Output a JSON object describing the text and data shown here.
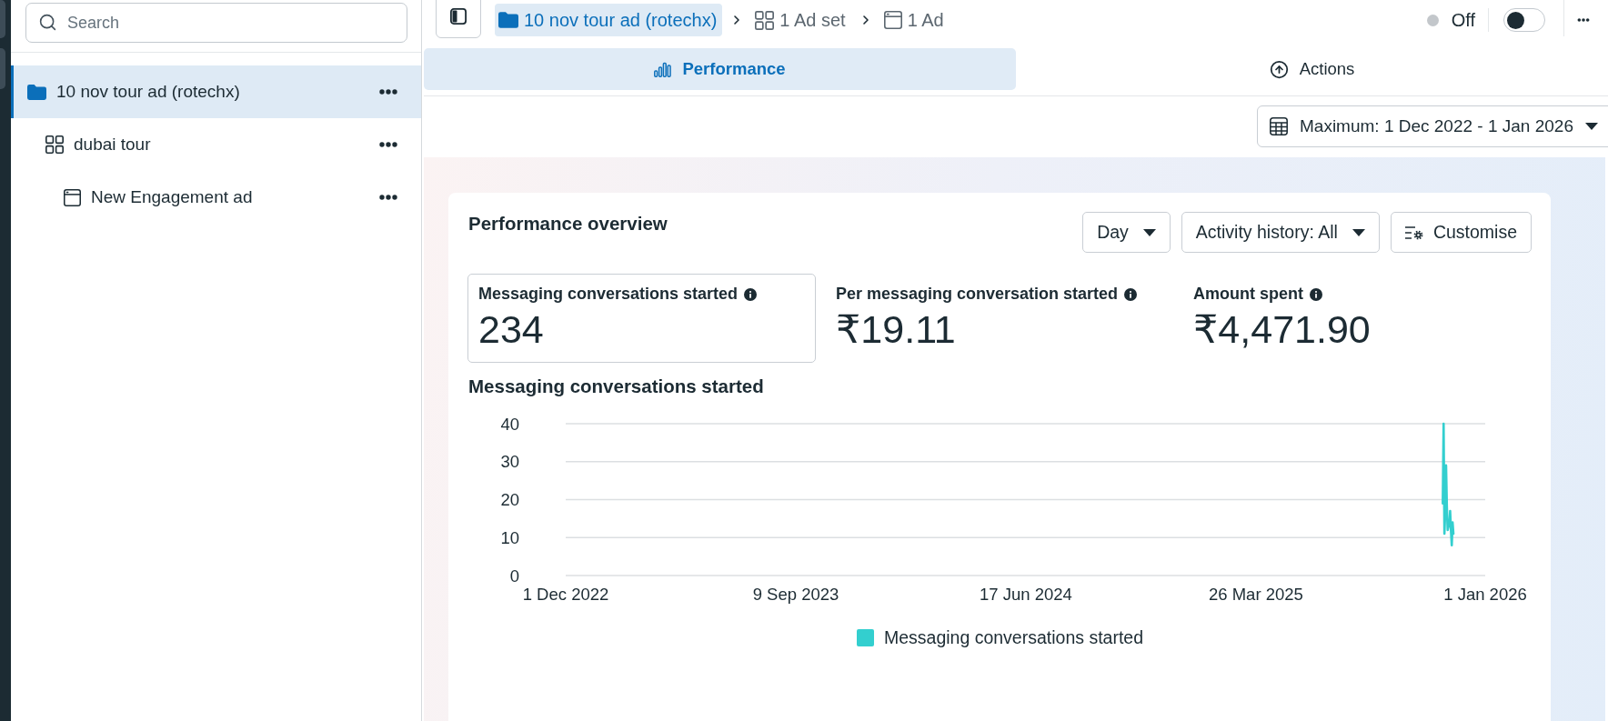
{
  "sidebar": {
    "search": {
      "placeholder": "Search"
    },
    "tree": [
      {
        "kind": "campaign",
        "label": "10 nov tour ad (rotechx)",
        "selected": true,
        "children": [
          {
            "kind": "ad_set",
            "label": "dubai tour",
            "selected": false,
            "children": [
              {
                "kind": "ad",
                "label": "New Engagement ad",
                "selected": false
              }
            ]
          }
        ]
      }
    ]
  },
  "toolbar": {
    "breadcrumbs": [
      {
        "kind": "campaign",
        "label": "10 nov tour ad (rotechx)",
        "selected": true
      },
      {
        "kind": "ad_set",
        "label": "1 Ad set",
        "selected": false
      },
      {
        "kind": "ad",
        "label": "1 Ad",
        "selected": false
      }
    ],
    "status": {
      "label": "Off",
      "on": false
    }
  },
  "tabs": [
    {
      "kind": "performance",
      "label": "Performance",
      "selected": true
    },
    {
      "kind": "actions",
      "label": "Actions",
      "selected": false
    }
  ],
  "date_range": {
    "label": "Maximum: 1 Dec 2022 - 1 Jan 2026"
  },
  "overview": {
    "title": "Performance overview",
    "controls": [
      {
        "kind": "dropdown",
        "label": "Day"
      },
      {
        "kind": "dropdown",
        "label": "Activity history: All"
      },
      {
        "kind": "customise",
        "label": "Customise"
      }
    ],
    "metrics": [
      {
        "label": "Messaging conversations started",
        "value": "234",
        "selected": true
      },
      {
        "label": "Per messaging conversation started",
        "value": "₹19.11",
        "selected": false
      },
      {
        "label": "Amount spent",
        "value": "₹4,471.90",
        "selected": false
      }
    ],
    "chart_data": {
      "type": "line",
      "title": "Messaging conversations started",
      "x": [
        "2025-11-10",
        "2025-11-11",
        "2025-11-12",
        "2025-11-13",
        "2025-11-14",
        "2025-11-15",
        "2025-11-16",
        "2025-11-17",
        "2025-11-18",
        "2025-11-19",
        "2025-11-20",
        "2025-11-21",
        "2025-11-22",
        "2025-11-23"
      ],
      "series": [
        {
          "name": "Messaging conversations started",
          "color": "#33cfcf",
          "values": [
            19,
            40,
            11,
            17,
            29,
            18,
            12,
            13,
            13,
            17,
            12,
            8,
            14,
            11
          ]
        }
      ],
      "xlim": [
        "2022-12-01",
        "2026-01-01"
      ],
      "ylim": [
        0,
        40
      ],
      "xticks": [
        {
          "value": "2022-12-01",
          "label": "1 Dec 2022"
        },
        {
          "value": "2023-09-09",
          "label": "9 Sep 2023"
        },
        {
          "value": "2024-06-17",
          "label": "17 Jun 2024"
        },
        {
          "value": "2025-03-26",
          "label": "26 Mar 2025"
        },
        {
          "value": "2026-01-01",
          "label": "1 Jan 2026"
        }
      ],
      "yticks": [
        0,
        10,
        20,
        30,
        40
      ],
      "grid": true
    }
  }
}
